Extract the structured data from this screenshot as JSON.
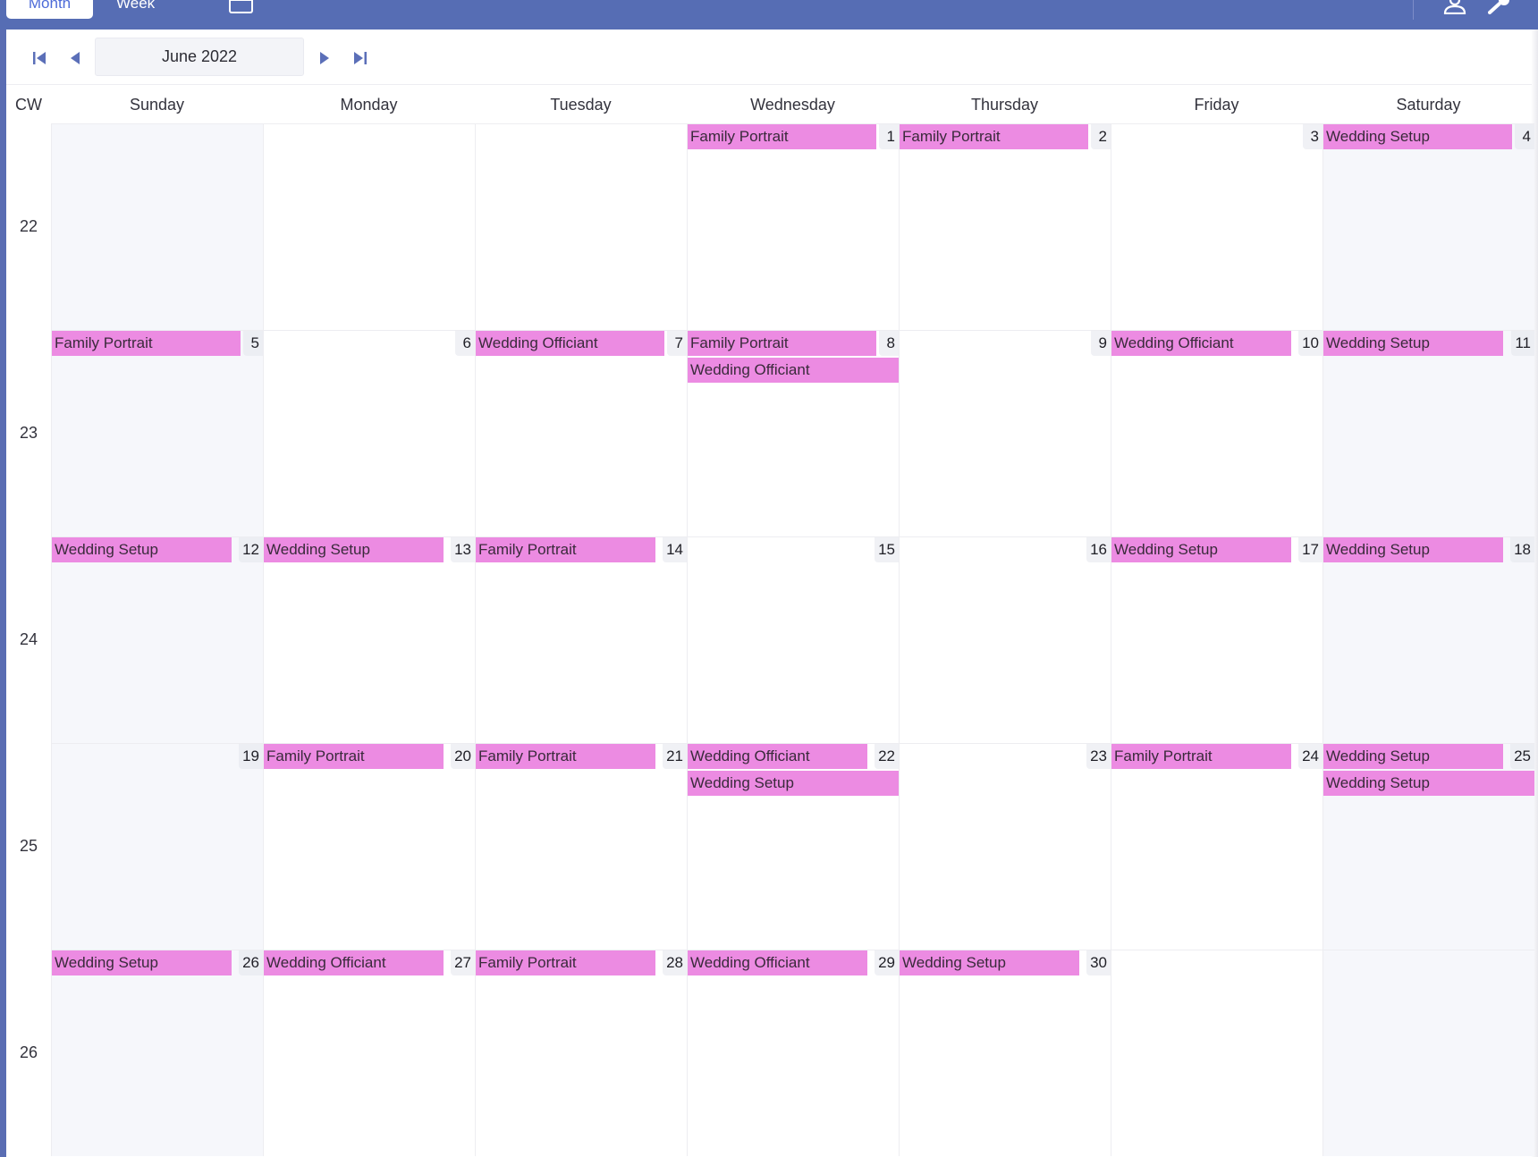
{
  "toolbar": {
    "tabs": [
      {
        "label": "Month",
        "active": true
      },
      {
        "label": "Week",
        "active": false
      }
    ]
  },
  "nav": {
    "month_label": "June 2022"
  },
  "calendar": {
    "cw_header": "CW",
    "weekdays": [
      "Sunday",
      "Monday",
      "Tuesday",
      "Wednesday",
      "Thursday",
      "Friday",
      "Saturday"
    ],
    "event_color": "#ec8be2",
    "weeks": [
      {
        "cw": "22",
        "days": [
          {
            "num": "",
            "events": []
          },
          {
            "num": "",
            "events": []
          },
          {
            "num": "",
            "events": []
          },
          {
            "num": "1",
            "events": [
              "Family Portrait"
            ]
          },
          {
            "num": "2",
            "events": [
              "Family Portrait"
            ]
          },
          {
            "num": "3",
            "events": []
          },
          {
            "num": "4",
            "events": [
              "Wedding Setup"
            ]
          }
        ]
      },
      {
        "cw": "23",
        "days": [
          {
            "num": "5",
            "events": [
              "Family Portrait"
            ]
          },
          {
            "num": "6",
            "events": []
          },
          {
            "num": "7",
            "events": [
              "Wedding Officiant"
            ]
          },
          {
            "num": "8",
            "events": [
              "Family Portrait",
              "Wedding Officiant"
            ]
          },
          {
            "num": "9",
            "events": []
          },
          {
            "num": "10",
            "events": [
              "Wedding Officiant"
            ]
          },
          {
            "num": "11",
            "events": [
              "Wedding Setup"
            ]
          }
        ]
      },
      {
        "cw": "24",
        "days": [
          {
            "num": "12",
            "events": [
              "Wedding Setup"
            ]
          },
          {
            "num": "13",
            "events": [
              "Wedding Setup"
            ]
          },
          {
            "num": "14",
            "events": [
              "Family Portrait"
            ]
          },
          {
            "num": "15",
            "events": []
          },
          {
            "num": "16",
            "events": []
          },
          {
            "num": "17",
            "events": [
              "Wedding Setup"
            ]
          },
          {
            "num": "18",
            "events": [
              "Wedding Setup"
            ]
          }
        ]
      },
      {
        "cw": "25",
        "days": [
          {
            "num": "19",
            "events": []
          },
          {
            "num": "20",
            "events": [
              "Family Portrait"
            ]
          },
          {
            "num": "21",
            "events": [
              "Family Portrait"
            ]
          },
          {
            "num": "22",
            "events": [
              "Wedding Officiant",
              "Wedding Setup"
            ]
          },
          {
            "num": "23",
            "events": []
          },
          {
            "num": "24",
            "events": [
              "Family Portrait"
            ]
          },
          {
            "num": "25",
            "events": [
              "Wedding Setup",
              "Wedding Setup"
            ]
          }
        ]
      },
      {
        "cw": "26",
        "days": [
          {
            "num": "26",
            "events": [
              "Wedding Setup"
            ]
          },
          {
            "num": "27",
            "events": [
              "Wedding Officiant"
            ]
          },
          {
            "num": "28",
            "events": [
              "Family Portrait"
            ]
          },
          {
            "num": "29",
            "events": [
              "Wedding Officiant"
            ]
          },
          {
            "num": "30",
            "events": [
              "Wedding Setup"
            ]
          },
          {
            "num": "",
            "events": []
          },
          {
            "num": "",
            "events": []
          }
        ]
      }
    ]
  }
}
